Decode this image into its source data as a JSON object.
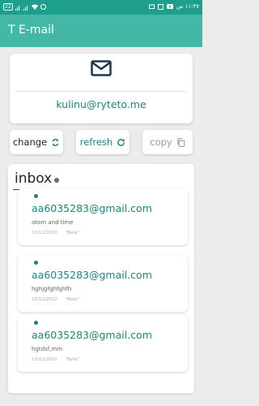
{
  "status_bar": {
    "battery": "22",
    "time": "١١:٣٧ ص",
    "icons": [
      "battery-icon",
      "signal-icon",
      "signal-icon",
      "wifi-icon",
      "alarm-icon",
      "clock-icon",
      "youtube-icon",
      "gallery-icon",
      "message-icon"
    ]
  },
  "app": {
    "title": "T E-mail"
  },
  "email_card": {
    "icon": "envelope-icon",
    "address": "kulinu@ryteto.me"
  },
  "actions": {
    "change": {
      "label": "change",
      "icon": "sync-icon"
    },
    "refresh": {
      "label": "refresh",
      "icon": "refresh-icon"
    },
    "copy": {
      "label": "copy",
      "icon": "copy-icon"
    }
  },
  "inbox": {
    "title": "inbox",
    "messages": [
      {
        "from": "aa6035283@gmail.com",
        "subject": "atom and time",
        "date": "10/12/2022",
        "tag": "Beta"
      },
      {
        "from": "aa6035283@gmail.com",
        "subject": "hghjgfghfghfh",
        "date": "10/12/2022",
        "tag": "Beta"
      },
      {
        "from": "aa6035283@gmail.com",
        "subject": "hgtdsf,mm",
        "date": "10/12/2022",
        "tag": "Beta"
      }
    ]
  },
  "colors": {
    "status_bar": "#1e9e8c",
    "app_bar": "#44b7a6",
    "accent": "#20827a",
    "background": "#ececec"
  }
}
